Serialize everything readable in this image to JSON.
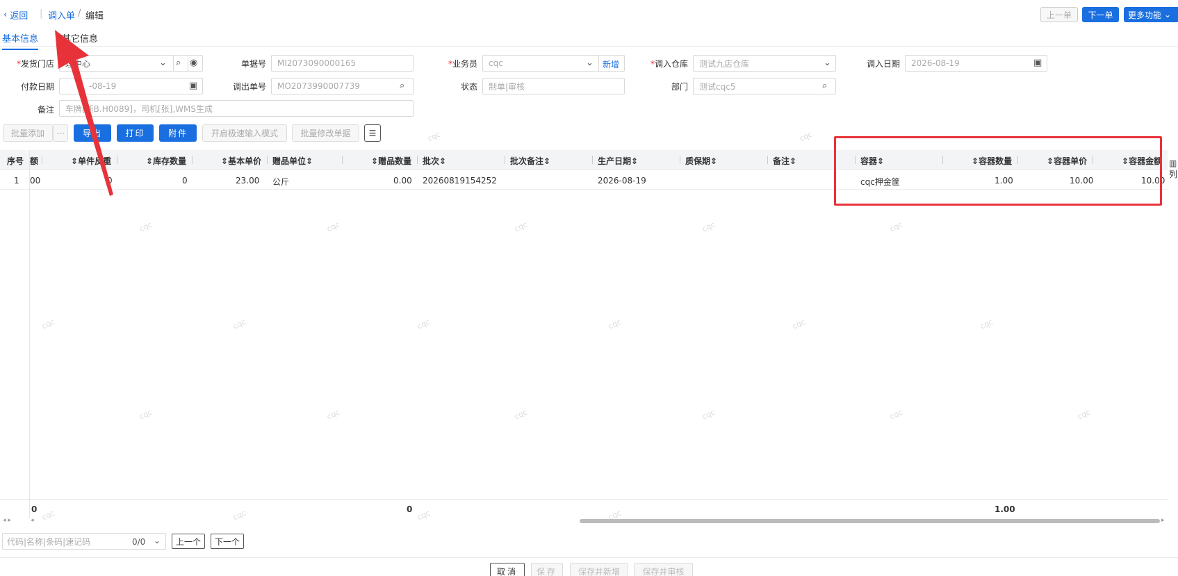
{
  "topbar": {
    "back_label": "返回",
    "crumb_parent": "调入单",
    "crumb_current": "编辑",
    "prev_label": "上一单",
    "next_label": "下一单",
    "more_label": "更多功能"
  },
  "tabs": [
    {
      "label": "基本信息",
      "active": true
    },
    {
      "label": "其它信息",
      "active": false
    }
  ],
  "form": {
    "ship_store_label": "发货门店",
    "ship_store_value": "理中心",
    "doc_no_label": "单据号",
    "doc_no_value": "MI2073090000165",
    "salesman_label": "业务员",
    "salesman_value": "cqc",
    "salesman_add": "新增",
    "in_warehouse_label": "调入仓库",
    "in_warehouse_value": "测试九店仓库",
    "in_date_label": "调入日期",
    "in_date_value": "2026-08-19",
    "pay_date_label": "付款日期",
    "pay_date_value": "-08-19",
    "out_doc_label": "调出单号",
    "out_doc_value": "MO2073990007739",
    "status_label": "状态",
    "status_value": "制单|审核",
    "dept_label": "部门",
    "dept_value": "测试cqc5",
    "remark_label": "备注",
    "remark_value": "车牌[浙B.H0089]，司机[张],WMS生成"
  },
  "toolbar": {
    "batch_add": "批量添加",
    "more_dots": "⋯",
    "export": "导出",
    "print": "打印",
    "attach": "附件",
    "fast_mode": "开启极速输入模式",
    "batch_edit": "批量修改单据"
  },
  "grid": {
    "headers": {
      "seq": "序号",
      "amount_partial": "额",
      "unit_weight": "单件反重",
      "stock_qty": "库存数量",
      "base_price": "基本单价",
      "gift_unit": "赠品单位",
      "gift_qty": "赠品数量",
      "batch": "批次",
      "batch_remark": "批次备注",
      "prod_date": "生产日期",
      "shelf_life": "质保期",
      "remark": "备注",
      "container": "容器",
      "container_qty": "容器数量",
      "container_price": "容器单价",
      "container_amount": "容器金额"
    },
    "rows": [
      {
        "seq": "1",
        "amount_partial": "00",
        "unit_weight": "0",
        "stock_qty": "0",
        "base_price": "23.00",
        "gift_unit": "公斤",
        "gift_qty": "0.00",
        "batch": "20260819154252",
        "batch_remark": "",
        "prod_date": "2026-08-19",
        "shelf_life": "",
        "remark": "",
        "container": "cqc押金筐",
        "container_qty": "1.00",
        "container_price": "10.00",
        "container_amount": "10.00"
      }
    ],
    "footer": {
      "first": "0",
      "gift_qty_total": "0",
      "container_qty_total": "1.00"
    },
    "side_label": "列"
  },
  "locate": {
    "placeholder": "代码|名称|条码|速记码",
    "count": "0/0",
    "prev": "上一个",
    "next": "下一个"
  },
  "bottom": {
    "cancel": "取消",
    "save": "保存",
    "save_new": "保存并新增",
    "save_audit": "保存并审核"
  },
  "watermark": "cqc",
  "colors": {
    "accent": "#1a6fe0",
    "annotation": "#e8323a"
  }
}
